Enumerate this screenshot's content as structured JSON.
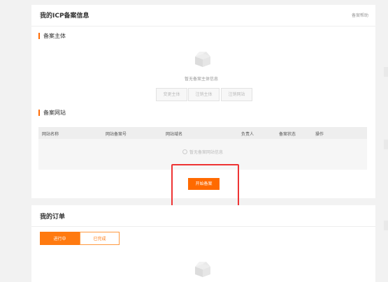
{
  "icp_card": {
    "title": "我的ICP备案信息",
    "header_link": "备案帮助",
    "subject_section": {
      "label": "备案主体",
      "empty_text": "暂无备案主体信息",
      "buttons": [
        "变更主体",
        "注销主体",
        "注销网站"
      ]
    },
    "website_section": {
      "label": "备案网站",
      "columns": [
        "网站名称",
        "网站备案号",
        "网站域名",
        "负责人",
        "备案状态",
        "操作"
      ],
      "empty_text": "暂无备案网站信息"
    },
    "start_button_label": "开始备案"
  },
  "orders_card": {
    "title": "我的订单",
    "tabs": [
      {
        "label": "进行中",
        "active": true
      },
      {
        "label": "已完成",
        "active": false
      }
    ]
  },
  "colors": {
    "accent": "#ff6a00",
    "highlight": "#e33333",
    "background": "#f2f2f2"
  }
}
